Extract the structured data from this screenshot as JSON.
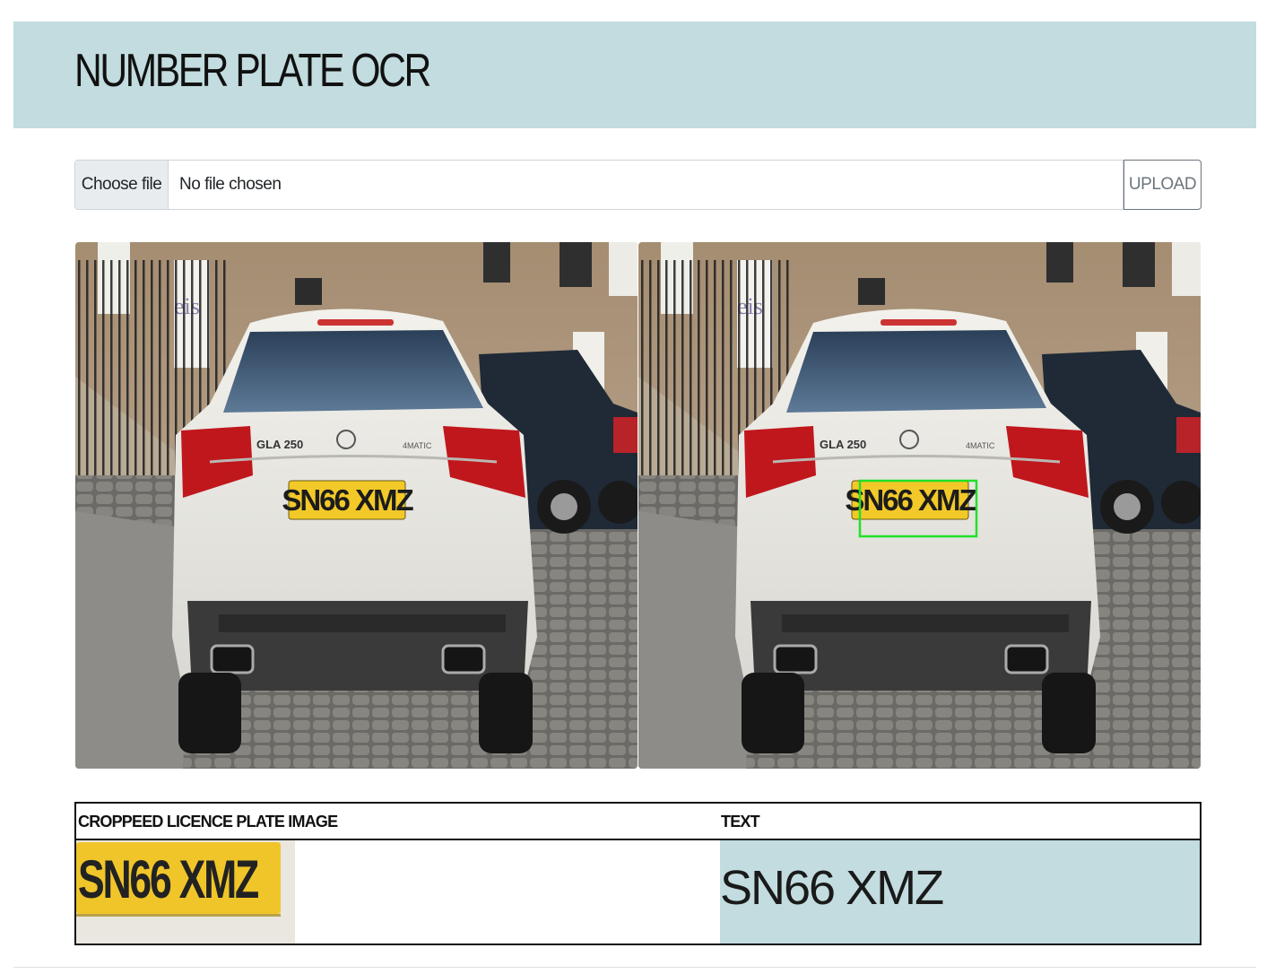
{
  "header": {
    "title": "NUMBER PLATE OCR",
    "background": "#c2dcdf"
  },
  "upload": {
    "choose_label": "Choose file",
    "status": "No file chosen",
    "upload_label": "UPLOAD"
  },
  "photos": {
    "plate_text": "SN66 XMZ",
    "model_badge": "GLA 250",
    "drive_badge": "4MATIC",
    "sign_text": "eis",
    "detection_color": "#22e02a"
  },
  "results": {
    "col_crop": "CROPPEED LICENCE PLATE IMAGE",
    "col_text": "TEXT",
    "cropped_plate": "SN66 XMZ",
    "recognized_text": "SN66 XMZ"
  }
}
